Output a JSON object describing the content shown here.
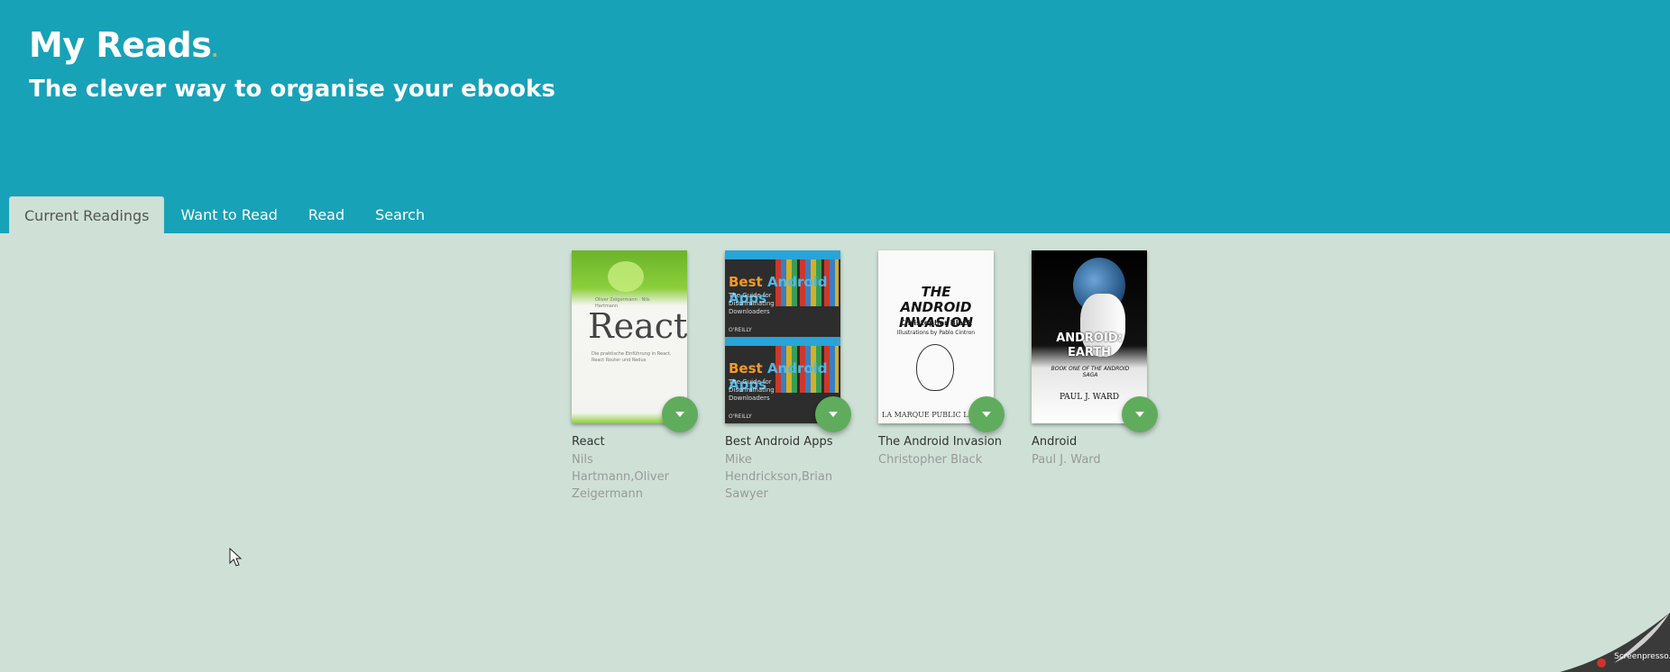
{
  "header": {
    "title": "My Reads",
    "title_dot": ".",
    "subtitle": "The clever way to organise your ebooks"
  },
  "tabs": [
    {
      "label": "Current Readings",
      "active": true
    },
    {
      "label": "Want to Read",
      "active": false
    },
    {
      "label": "Read",
      "active": false
    },
    {
      "label": "Search",
      "active": false
    }
  ],
  "books": [
    {
      "title": "React",
      "authors": "Nils Hartmann,Oliver Zeigermann",
      "cover": {
        "word": "React",
        "small": "Oliver Zeigermann · Nils Hartmann",
        "tagline": "Die praktische Einführung in React, React Router und Redux"
      }
    },
    {
      "title": "Best Android Apps",
      "authors": "Mike Hendrickson,Brian Sawyer",
      "cover": {
        "title_a": "Best ",
        "title_b": "Android Apps",
        "sub": "The Guide for Discriminating Downloaders",
        "publisher": "O'REILLY"
      }
    },
    {
      "title": "The Android Invasion",
      "authors": "Christopher Black",
      "cover": {
        "title": "THE ANDROID INVASION",
        "author": "Christopher Black",
        "illus": "Illustrations by Pablo Cintron",
        "publisher": "LA MARQUE PUBLIC LIBR"
      }
    },
    {
      "title": "Android",
      "authors": "Paul J. Ward",
      "cover": {
        "title": "ANDROID: EARTH",
        "sub": "BOOK ONE OF THE ANDROID SAGA",
        "author": "PAUL J. WARD"
      }
    }
  ],
  "watermark": "Screenpresso.com",
  "colors": {
    "header": "#17a2b8",
    "background": "#cfe1d7",
    "shelf_button": "#60ac5d"
  }
}
